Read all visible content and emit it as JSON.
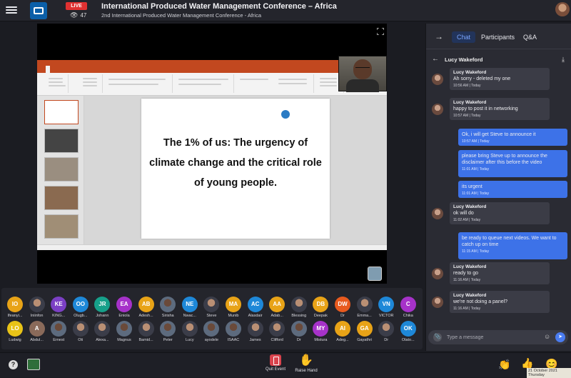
{
  "header": {
    "live_label": "LIVE",
    "viewer_count": "47",
    "title": "International Produced Water Management Conference – Africa",
    "subtitle": "2nd International Produced Water Management Conference - Africa"
  },
  "slide": {
    "text": "The 1% of us: The urgency of climate change and the critical role of young people."
  },
  "panel": {
    "tabs": [
      "Chat",
      "Participants",
      "Q&A"
    ],
    "active_tab": "Chat",
    "conversation_with": "Lucy Wakeford",
    "input_placeholder": "Type a message"
  },
  "messages": [
    {
      "dir": "in",
      "author": "Lucy Wakeford",
      "text": "Ah sorry - deleted my one",
      "time": "10:56 AM | Today"
    },
    {
      "dir": "in",
      "author": "Lucy Wakeford",
      "text": "happy to post it in networking",
      "time": "10:57 AM | Today"
    },
    {
      "dir": "out",
      "text": "Ok, i will get Steve to announce it",
      "time": "10:57 AM | Today"
    },
    {
      "dir": "out",
      "text": "please bring Steve up to announce the disclaimer after this before the video",
      "time": "11:01 AM | Today"
    },
    {
      "dir": "out",
      "text": "its urgent",
      "time": "11:01 AM | Today"
    },
    {
      "dir": "in",
      "author": "Lucy Wakeford",
      "text": "ok will do",
      "time": "11:02 AM | Today"
    },
    {
      "dir": "out",
      "text": "be ready to queue next videos. We want to catch up on time",
      "time": "11:15 AM | Today"
    },
    {
      "dir": "in",
      "author": "Lucy Wakeford",
      "text": "ready to go",
      "time": "11:16 AM | Today"
    },
    {
      "dir": "in",
      "author": "Lucy Wakeford",
      "text": "we're not doing a panel?",
      "time": "11:16 AM | Today"
    }
  ],
  "participants": [
    {
      "initials": "IO",
      "name": "Ifeanyi...",
      "color": "#e8a317"
    },
    {
      "initials": "",
      "name": "Iniinfon",
      "color": "photo"
    },
    {
      "initials": "KE",
      "name": "KING...",
      "color": "#7b3fc4"
    },
    {
      "initials": "OO",
      "name": "Olugb...",
      "color": "#1e88d8"
    },
    {
      "initials": "JR",
      "name": "Johann",
      "color": "#16a08a"
    },
    {
      "initials": "EA",
      "name": "Eniola",
      "color": "#a632c9"
    },
    {
      "initials": "AB",
      "name": "Adesh...",
      "color": "#e8a317"
    },
    {
      "initials": "",
      "name": "Sirisha",
      "color": "photo2"
    },
    {
      "initials": "NE",
      "name": "Nwac...",
      "color": "#1e88d8"
    },
    {
      "initials": "",
      "name": "Steve",
      "color": "photo"
    },
    {
      "initials": "MA",
      "name": "Munib",
      "color": "#e8a317"
    },
    {
      "initials": "AC",
      "name": "Alasdair",
      "color": "#1e88d8"
    },
    {
      "initials": "AA",
      "name": "Adab...",
      "color": "#e8a317"
    },
    {
      "initials": "",
      "name": "Blessing",
      "color": "photo"
    },
    {
      "initials": "DB",
      "name": "Deepak",
      "color": "#e8a317"
    },
    {
      "initials": "DW",
      "name": "Dr",
      "color": "#e85a1e"
    },
    {
      "initials": "",
      "name": "Emma...",
      "color": "photo"
    },
    {
      "initials": "VN",
      "name": "VICTOR",
      "color": "#1e88d8"
    },
    {
      "initials": "C",
      "name": "Chika",
      "color": "#a632c9"
    },
    {
      "initials": "LO",
      "name": "Ludwig",
      "color": "#e8c317"
    },
    {
      "initials": "A",
      "name": "Abdul...",
      "color": "#8a6a5a"
    },
    {
      "initials": "",
      "name": "Ernest",
      "color": "photo2"
    },
    {
      "initials": "",
      "name": "Oti",
      "color": "photo"
    },
    {
      "initials": "",
      "name": "Alexa...",
      "color": "photo"
    },
    {
      "initials": "",
      "name": "Magnus",
      "color": "photo2"
    },
    {
      "initials": "",
      "name": "Bamid...",
      "color": "photo"
    },
    {
      "initials": "",
      "name": "Peter",
      "color": "photo2"
    },
    {
      "initials": "",
      "name": "Lucy",
      "color": "photo"
    },
    {
      "initials": "",
      "name": "ayodele",
      "color": "photo2"
    },
    {
      "initials": "",
      "name": "ISAAC",
      "color": "photo2"
    },
    {
      "initials": "",
      "name": "James",
      "color": "photo"
    },
    {
      "initials": "",
      "name": "Clifford",
      "color": "photo"
    },
    {
      "initials": "",
      "name": "Dr",
      "color": "photo2"
    },
    {
      "initials": "MY",
      "name": "Mistura",
      "color": "#a632c9"
    },
    {
      "initials": "AI",
      "name": "Adeg...",
      "color": "#e8a317"
    },
    {
      "initials": "GA",
      "name": "Gayathri",
      "color": "#e8a317"
    },
    {
      "initials": "",
      "name": "Dr",
      "color": "photo"
    },
    {
      "initials": "OK",
      "name": "Olato...",
      "color": "#1e88d8"
    }
  ],
  "bottom": {
    "quit_label": "Quit Event",
    "raise_label": "Raise Hand",
    "date_line1": "21 October 2021",
    "date_line2": "Thursday"
  }
}
